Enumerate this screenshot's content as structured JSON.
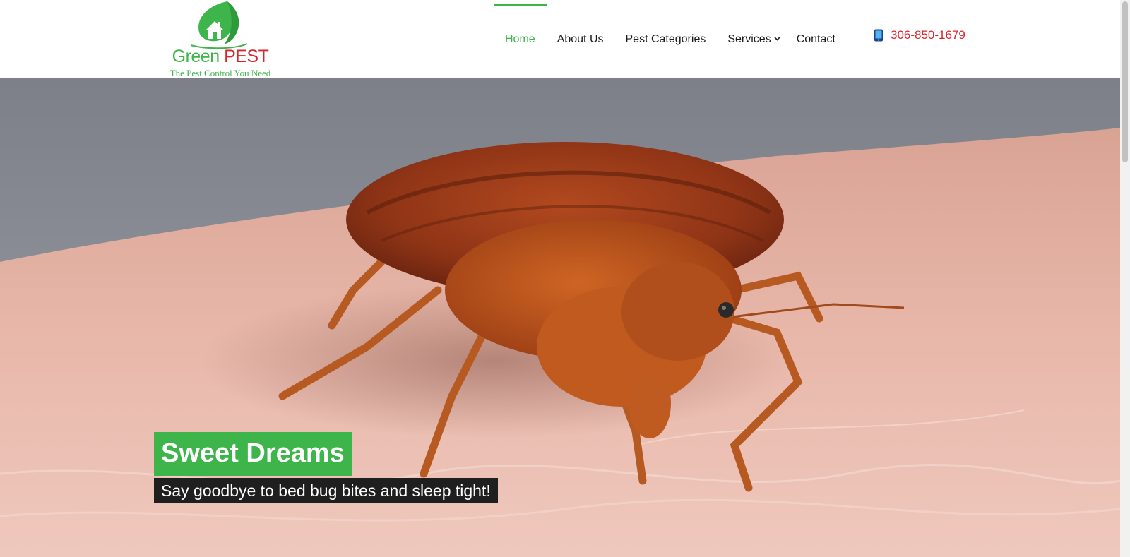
{
  "brand": {
    "name_part1": "Green",
    "name_part2": "PEST",
    "tagline": "The Pest Control You Need",
    "colors": {
      "green": "#3db54a",
      "red": "#d7262d"
    }
  },
  "nav": {
    "items": [
      {
        "label": "Home",
        "active": true
      },
      {
        "label": "About Us",
        "active": false
      },
      {
        "label": "Pest Categories",
        "active": false
      },
      {
        "label": "Services",
        "active": false
      },
      {
        "label": "Contact",
        "active": false
      }
    ]
  },
  "contact": {
    "phone": "306-850-1679",
    "icon": "mobile-phone-icon"
  },
  "hero": {
    "image": "bed-bug-on-skin-photo",
    "title": "Sweet Dreams",
    "subtitle": "Say goodbye to bed bug bites and sleep tight!"
  }
}
